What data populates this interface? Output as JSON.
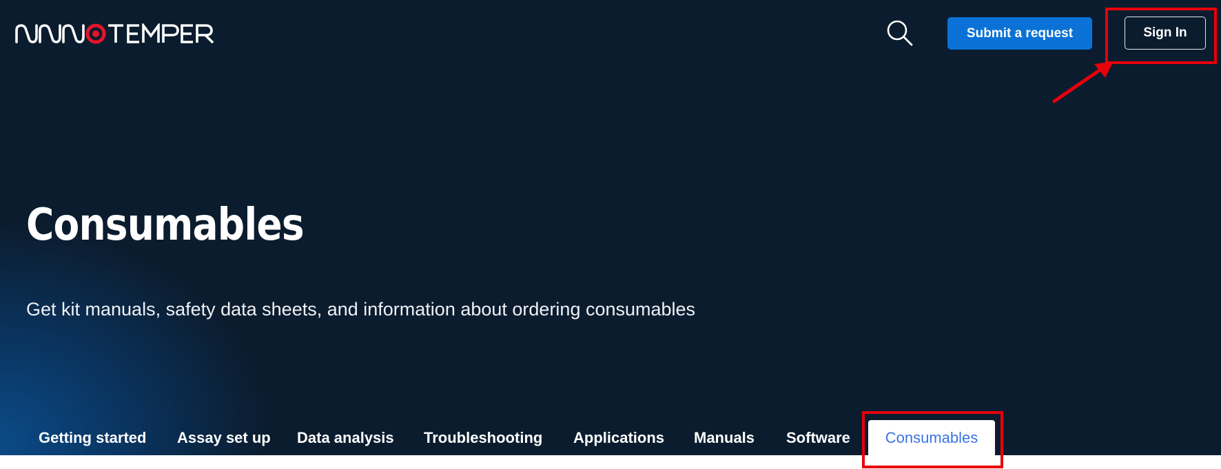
{
  "header": {
    "logo_text": "NANOTEMPER",
    "search_icon": "search-icon",
    "submit_label": "Submit a request",
    "signin_label": "Sign In"
  },
  "hero": {
    "title": "Consumables",
    "subtitle": "Get kit manuals, safety data sheets, and information about ordering consumables"
  },
  "tabs": [
    {
      "label": "Getting started"
    },
    {
      "label": "Assay set up"
    },
    {
      "label": "Data analysis"
    },
    {
      "label": "Troubleshooting"
    },
    {
      "label": "Applications"
    },
    {
      "label": "Manuals"
    },
    {
      "label": "Software"
    },
    {
      "label": "Consumables",
      "active": true
    }
  ],
  "colors": {
    "background": "#0b1c2e",
    "accent": "#0a72d6",
    "active_tab_text": "#3a73e3",
    "annotation": "#e8000a"
  },
  "annotations": {
    "highlight_color": "#e8000a",
    "arrow_icon": "arrow-up-right-icon"
  }
}
